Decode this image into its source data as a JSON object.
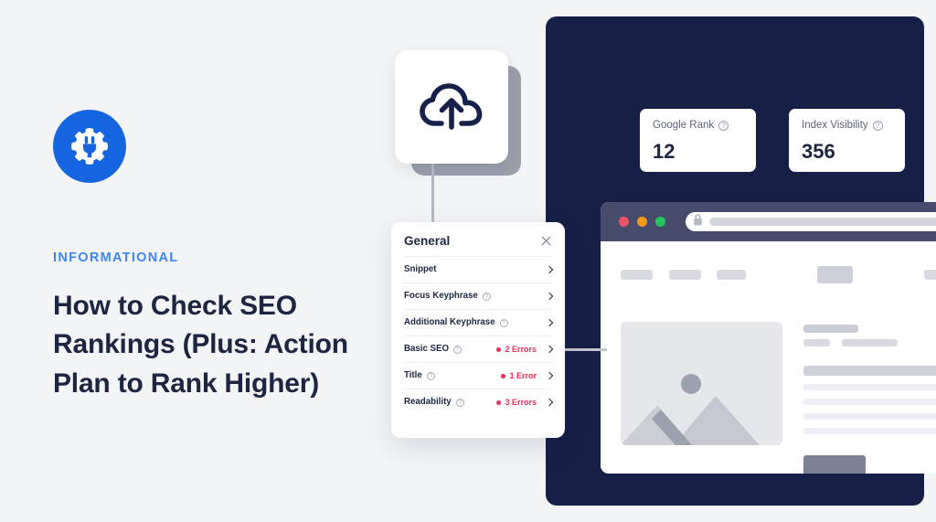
{
  "brand": {
    "logo_icon": "gear-plug-icon",
    "accent_color": "#1665e0"
  },
  "article": {
    "eyebrow": "INFORMATIONAL",
    "eyebrow_color": "#3b88f5",
    "headline": "How to Check SEO Rankings (Plus: Action Plan to Rank Higher)",
    "headline_color": "#1e2542"
  },
  "dashboard": {
    "background_color": "#161f45",
    "metrics": [
      {
        "label": "Google Rank",
        "value": "12",
        "help_icon": "help-circle-icon"
      },
      {
        "label": "Index Visibility",
        "value": "356",
        "help_icon": "help-circle-icon"
      }
    ]
  },
  "browser": {
    "chrome_color": "#464c69",
    "traffic_lights": [
      {
        "name": "close-dot",
        "color": "#f2506a"
      },
      {
        "name": "minimize-dot",
        "color": "#f09819"
      },
      {
        "name": "maximize-dot",
        "color": "#22c55e"
      }
    ],
    "address_bar": {
      "lock_icon": "lock-icon",
      "url_placeholder": ""
    },
    "content": {
      "image_placeholder_icon": "image-placeholder-icon",
      "cta_label": ""
    }
  },
  "upload_card": {
    "icon": "cloud-upload-icon"
  },
  "seo_panel": {
    "title": "General",
    "close_icon": "close-icon",
    "items": [
      {
        "label": "Snippet",
        "has_help": false,
        "status": "",
        "chevron": "chevron-right-icon"
      },
      {
        "label": "Focus Keyphrase",
        "has_help": true,
        "status": "",
        "chevron": "chevron-right-icon"
      },
      {
        "label": "Additional Keyphrase",
        "has_help": true,
        "status": "",
        "chevron": "chevron-right-icon"
      },
      {
        "label": "Basic SEO",
        "has_help": true,
        "status": "2 Errors",
        "chevron": "chevron-right-icon"
      },
      {
        "label": "Title",
        "has_help": true,
        "status": "1 Error",
        "chevron": "chevron-right-icon"
      },
      {
        "label": "Readability",
        "has_help": true,
        "status": "3 Errors",
        "chevron": "chevron-right-icon"
      }
    ],
    "error_color": "#ef2a53"
  }
}
